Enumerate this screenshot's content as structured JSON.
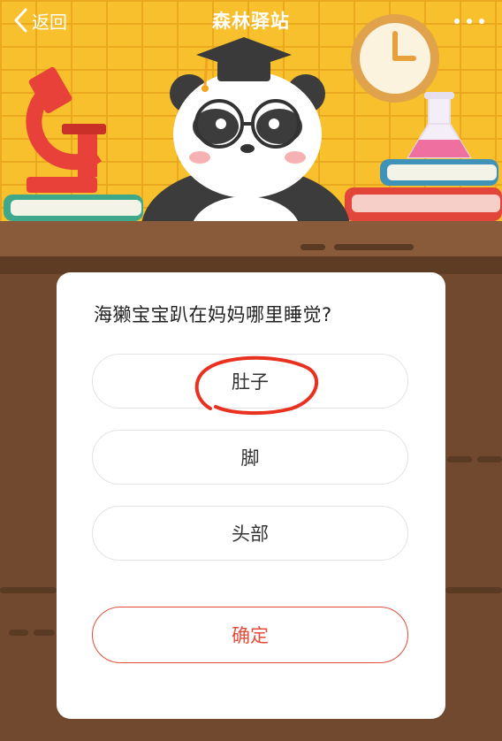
{
  "nav": {
    "back_label": "返回",
    "title": "森林驿站",
    "back_icon": "chevron-left-icon",
    "more_icon": "more-dots-icon"
  },
  "quiz": {
    "question": "海獭宝宝趴在妈妈哪里睡觉?",
    "options": [
      {
        "label": "肚子"
      },
      {
        "label": "脚"
      },
      {
        "label": "头部"
      }
    ],
    "confirm_label": "确定"
  },
  "colors": {
    "background_yellow": "#f7c02c",
    "desk_brown": "#70492e",
    "confirm_red": "#e44c3a",
    "annotation_red": "#e8321f"
  }
}
